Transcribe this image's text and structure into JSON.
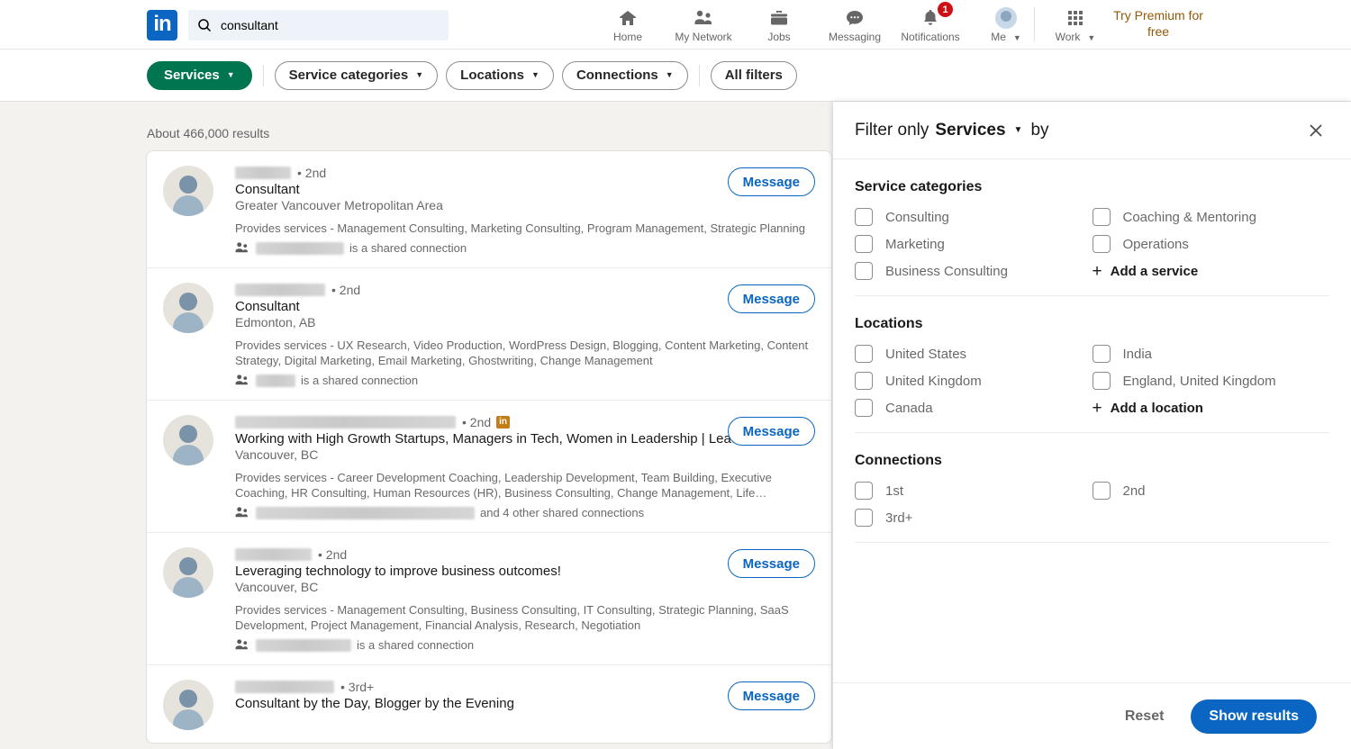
{
  "header": {
    "logo_alt": "LinkedIn",
    "search": {
      "value": "consultant",
      "placeholder": "Search",
      "icon": "search-icon"
    },
    "nav": [
      {
        "label": "Home",
        "icon": "home-icon"
      },
      {
        "label": "My Network",
        "icon": "network-icon"
      },
      {
        "label": "Jobs",
        "icon": "briefcase-icon"
      },
      {
        "label": "Messaging",
        "icon": "messaging-icon"
      },
      {
        "label": "Notifications",
        "icon": "bell-icon",
        "badge": "1"
      },
      {
        "label": "Me",
        "icon": "avatar-icon",
        "caret": "▼"
      },
      {
        "label": "Work",
        "icon": "grid-icon",
        "caret": "▼"
      }
    ],
    "premium": {
      "label": "Try Premium for free",
      "color": "#915907"
    }
  },
  "filterbar": {
    "active_pill": {
      "label": "Services",
      "caret": "▼",
      "color": "#01754f"
    },
    "pills": [
      {
        "label": "Service categories",
        "caret": "▼"
      },
      {
        "label": "Locations",
        "caret": "▼"
      },
      {
        "label": "Connections",
        "caret": "▼"
      }
    ],
    "all_filters": {
      "label": "All filters"
    }
  },
  "results": {
    "count_text": "About 466,000 results",
    "message_label": "Message",
    "items": [
      {
        "name_redacted": true,
        "name_width": 62,
        "degree": "• 2nd",
        "in_badge": "",
        "title": "Consultant",
        "location": "Greater Vancouver Metropolitan Area",
        "services": "Provides services - Management Consulting, Marketing Consulting, Program Management, Strategic Planning",
        "shared_width": 98,
        "shared_text": "is a shared connection"
      },
      {
        "name_redacted": true,
        "name_width": 100,
        "degree": "• 2nd",
        "in_badge": "",
        "title": "Consultant",
        "location": "Edmonton, AB",
        "services": "Provides services - UX Research, Video Production, WordPress Design, Blogging, Content Marketing, Content Strategy, Digital Marketing, Email Marketing, Ghostwriting, Change Management",
        "shared_width": 44,
        "shared_text": "is a shared connection"
      },
      {
        "name_redacted": true,
        "name_width": 245,
        "degree": "• 2nd",
        "in_badge": "in",
        "title": "Working with High Growth Startups, Managers in Tech, Women in Leadership | Leadershi…",
        "location": "Vancouver, BC",
        "services": "Provides services - Career Development Coaching, Leadership Development, Team Building, Executive Coaching, HR Consulting, Human Resources (HR), Business Consulting, Change Management, Life…",
        "shared_width": 243,
        "shared_text": "and 4 other shared connections"
      },
      {
        "name_redacted": true,
        "name_width": 85,
        "degree": "• 2nd",
        "in_badge": "",
        "title": "Leveraging technology to improve business outcomes!",
        "location": "Vancouver, BC",
        "services": "Provides services - Management Consulting, Business Consulting, IT Consulting, Strategic Planning, SaaS Development, Project Management, Financial Analysis, Research, Negotiation",
        "shared_width": 106,
        "shared_text": "is a shared connection"
      },
      {
        "name_redacted": true,
        "name_width": 110,
        "degree": "• 3rd+",
        "in_badge": "",
        "title": "Consultant by the Day, Blogger by the Evening",
        "location": "",
        "services": "",
        "shared_width": 0,
        "shared_text": ""
      }
    ]
  },
  "panel": {
    "title_prefix": "Filter only",
    "title_selected": "Services",
    "title_caret": "▼",
    "title_suffix": "by",
    "close_icon": "close-icon",
    "sections": [
      {
        "heading": "Service categories",
        "options": [
          "Consulting",
          "Coaching & Mentoring",
          "Marketing",
          "Operations",
          "Business Consulting"
        ],
        "add_label": "Add a service",
        "add_plus": "+"
      },
      {
        "heading": "Locations",
        "options": [
          "United States",
          "India",
          "United Kingdom",
          "England, United Kingdom",
          "Canada"
        ],
        "add_label": "Add a location",
        "add_plus": "+"
      },
      {
        "heading": "Connections",
        "options": [
          "1st",
          "2nd",
          "3rd+"
        ],
        "add_label": "",
        "add_plus": ""
      }
    ],
    "footer": {
      "reset_label": "Reset",
      "show_results_label": "Show results",
      "accent_color": "#0a66c2"
    }
  }
}
